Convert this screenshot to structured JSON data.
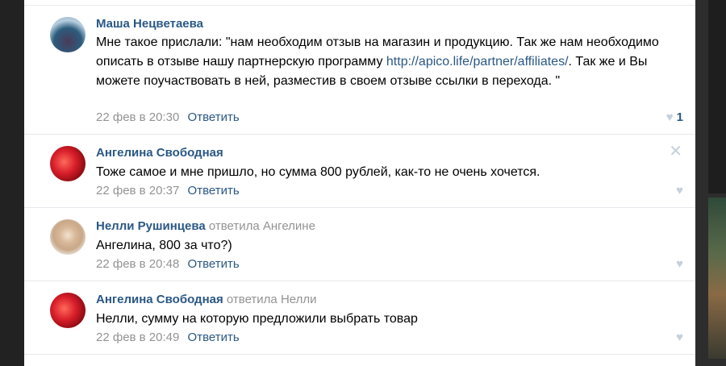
{
  "comments": [
    {
      "author": "Маша Нецветаева",
      "replied_to": "",
      "text_before_link": "Мне такое прислали: \"нам необходим отзыв на магазин и продукцию. Так же нам необходимо описать в отзыве нашу партнерскую программу ",
      "link": "http://apico.life/partner/affiliates/",
      "text_after_link": ". Так же и Вы можете поучаствовать в ней, разместив в своем отзыве ссылки в перехода. \"",
      "date": "22 фев в 20:30",
      "reply_label": "Ответить",
      "likes": "1"
    },
    {
      "author": "Ангелина Свободная",
      "replied_to": "",
      "text": "Тоже самое и мне пришло, но сумма 800 рублей, как-то не очень хочется.",
      "date": "22 фев в 20:37",
      "reply_label": "Ответить",
      "likes": ""
    },
    {
      "author": "Нелли Рушинцева",
      "replied_to": "ответила Ангелине",
      "text": "Ангелина, 800 за что?)",
      "date": "22 фев в 20:48",
      "reply_label": "Ответить",
      "likes": ""
    },
    {
      "author": "Ангелина Свободная",
      "replied_to": "ответила Нелли",
      "text": "Нелли, сумму на которую предложили выбрать товар",
      "date": "22 фев в 20:49",
      "reply_label": "Ответить",
      "likes": ""
    }
  ],
  "icons": {
    "like": "heart-icon",
    "delete": "close-icon"
  },
  "colors": {
    "name": "#2a5885",
    "muted": "#939393",
    "icon": "#c5d0db",
    "divider": "#e7e8ec"
  }
}
